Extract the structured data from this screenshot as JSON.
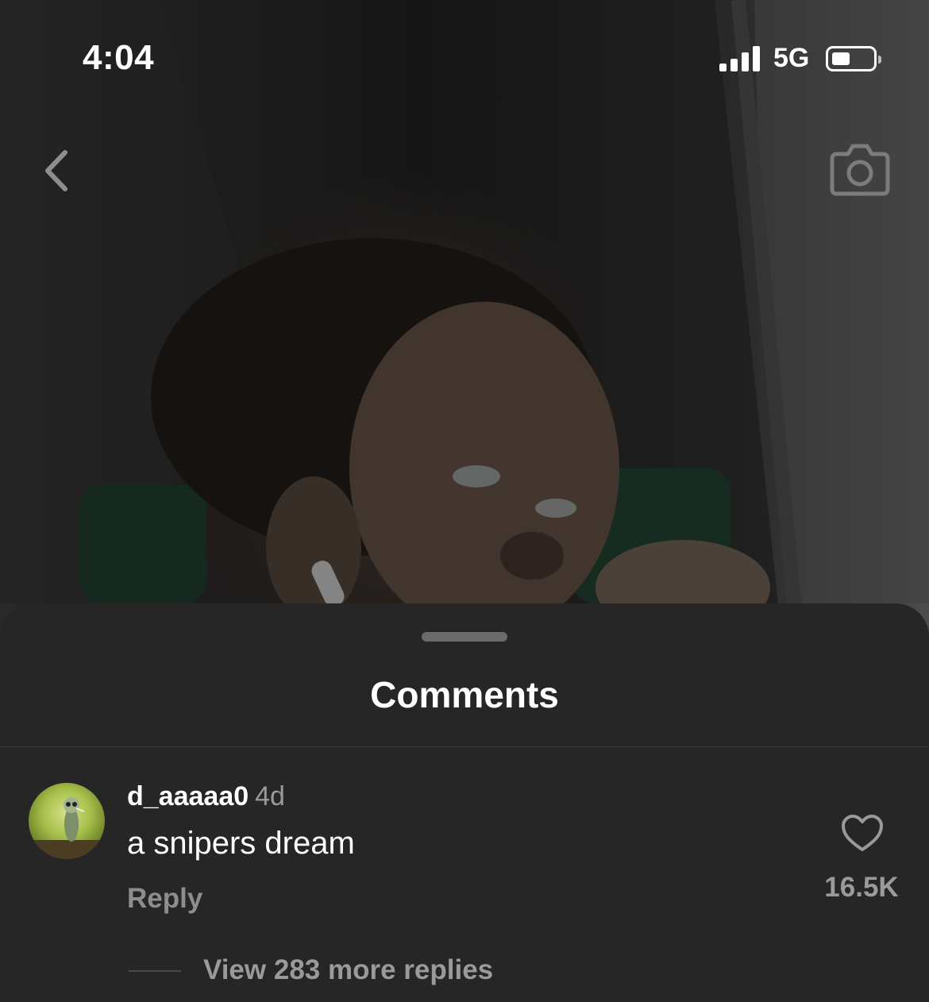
{
  "status_bar": {
    "time": "4:04",
    "network": "5G"
  },
  "icons": {
    "back": "chevron-left-icon",
    "camera": "camera-icon",
    "like": "heart-icon"
  },
  "sheet": {
    "title": "Comments"
  },
  "comment": {
    "username": "d_aaaaa0",
    "time_ago": "4d",
    "text": "a snipers dream",
    "reply_label": "Reply",
    "like_count": "16.5K",
    "view_replies_label": "View 283 more replies"
  },
  "colors": {
    "sheet_bg": "#262626",
    "muted_text": "#9a9a9a"
  }
}
